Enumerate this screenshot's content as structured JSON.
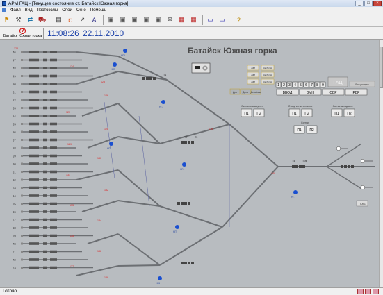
{
  "window": {
    "title": "АРМ ГАЦ - [Текущее состояние ст. Батайск Южная горка]",
    "min": "_",
    "max": "□",
    "close": "×"
  },
  "menu": [
    "Файл",
    "Вид",
    "Протоколы",
    "Слои",
    "Окно",
    "Помощь"
  ],
  "toolbar": {
    "icons": [
      "signal-tool-icon",
      "hammer-tool-icon",
      "switch-tool-icon",
      "car-tool-icon",
      "save-icon",
      "camera-icon",
      "graph-icon",
      "az-icon",
      "folder-icon",
      "folder-icon",
      "folder-icon",
      "folder-icon",
      "folder-icon",
      "mail-icon",
      "print-red-icon",
      "print-red-icon",
      "window-icon",
      "window-icon",
      "help-icon"
    ],
    "glyphs": [
      "⚑",
      "⚒",
      "⇄",
      "⛟",
      "▤",
      "◘",
      "↗",
      "A",
      "▣",
      "▣",
      "▣",
      "▣",
      "▣",
      "✉",
      "▦",
      "▦",
      "▭",
      "▭",
      "?"
    ]
  },
  "station_tab": {
    "icon": "?",
    "label": "Батайск Южная горка"
  },
  "clock": {
    "time": "11:08:26",
    "date": "22.11.2010"
  },
  "scheme": {
    "title": "Батайск Южная горка",
    "track_numbers": [
      "46",
      "47",
      "48",
      "49",
      "50",
      "51",
      "52",
      "53",
      "54",
      "55",
      "56",
      "57",
      "58",
      "59",
      "60",
      "61",
      "62",
      "63",
      "64",
      "65",
      "66",
      "67",
      "68",
      "69",
      "70",
      "71",
      "72",
      "73"
    ],
    "switch_labels": [
      "123",
      "124",
      "125",
      "126",
      "127",
      "128",
      "129",
      "130",
      "131",
      "132",
      "133",
      "134",
      "135",
      "136",
      "137",
      "138",
      "139",
      "140"
    ],
    "signals": [
      "НГ1",
      "НГ2",
      "НГ3",
      "НГ4",
      "НГ5",
      "НГ6",
      "НГ7",
      "НГ8"
    ],
    "route_buttons": [
      "1",
      "2",
      "3",
      "4",
      "5",
      "6",
      "7",
      "8",
      "9"
    ],
    "gats": "ГАЦ",
    "vyk_label": "Вык.роспуск",
    "mode_buttons": [
      "ВВОД",
      "ЗМН",
      "СБР",
      "РВР"
    ],
    "small_btns": [
      "Дек",
      "День",
      "Дсчеlonь"
    ],
    "side_tags": [
      "Зап",
      "Зап",
      "Зап"
    ],
    "side_status": [
      "3апТрбН",
      "3апТрбН",
      "3апТрбН"
    ],
    "groups": [
      {
        "title": "Сигналы замедлен",
        "buttons": [
          "П1",
          "П2"
        ]
      },
      {
        "title": "Отвод из вагонников",
        "buttons": [
          "П1",
          "П2"
        ]
      },
      {
        "title": "Сигналы надвига",
        "buttons": [
          "П1",
          "П2"
        ]
      },
      {
        "title": "Сигнал",
        "buttons": [
          "П1",
          "П2"
        ]
      }
    ],
    "misc": [
      "Т1",
      "Т2",
      "Т3",
      "Т4",
      "ТЭВ"
    ],
    "bottom_tag": "ПОВ1"
  },
  "status": {
    "text": "Готово"
  }
}
